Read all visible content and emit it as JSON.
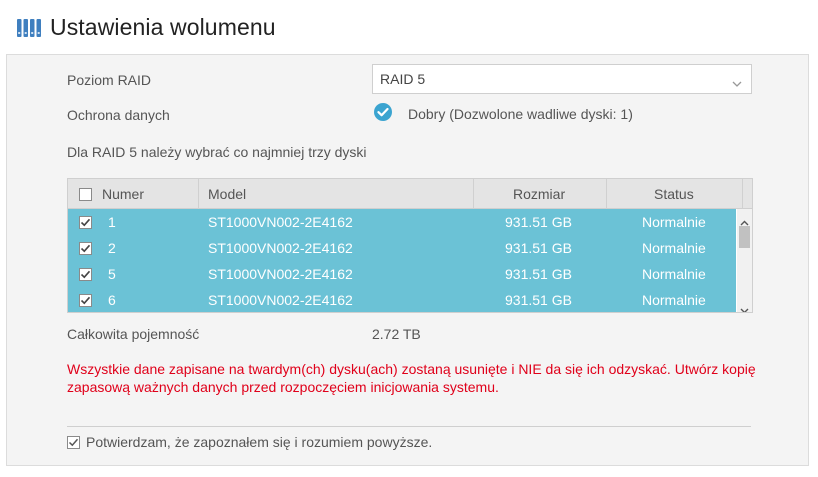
{
  "header": {
    "title": "Ustawienia wolumenu",
    "icon": "disk-stack-icon"
  },
  "form": {
    "raid_level_label": "Poziom RAID",
    "raid_level_value": "RAID 5",
    "protection_label": "Ochrona danych",
    "protection_value": "Dobry (Dozwolone wadliwe dyski: 1)",
    "hint": "Dla RAID 5 należy wybrać co najmniej trzy dyski"
  },
  "table": {
    "headers": {
      "number": "Numer",
      "model": "Model",
      "size": "Rozmiar",
      "status": "Status"
    },
    "header_checked": false,
    "rows": [
      {
        "checked": true,
        "number": "1",
        "model": "ST1000VN002-2E4162",
        "size": "931.51 GB",
        "status": "Normalnie"
      },
      {
        "checked": true,
        "number": "2",
        "model": "ST1000VN002-2E4162",
        "size": "931.51 GB",
        "status": "Normalnie"
      },
      {
        "checked": true,
        "number": "5",
        "model": "ST1000VN002-2E4162",
        "size": "931.51 GB",
        "status": "Normalnie"
      },
      {
        "checked": true,
        "number": "6",
        "model": "ST1000VN002-2E4162",
        "size": "931.51 GB",
        "status": "Normalnie"
      }
    ],
    "selected_row_color": "#6bc2d6"
  },
  "summary": {
    "capacity_label": "Całkowita pojemność",
    "capacity_value": "2.72 TB"
  },
  "warning": {
    "text": "Wszystkie dane zapisane na twardym(ch) dysku(ach) zostaną usunięte i NIE da się ich odzyskać. Utwórz kopię zapasową ważnych danych przed rozpoczęciem inicjowania systemu.",
    "color": "#e0001a"
  },
  "confirm": {
    "label": "Potwierdzam, że zapoznałem się i rozumiem powyższe.",
    "checked": true
  },
  "colors": {
    "accent": "#3ba4d0",
    "panel_bg": "#f4f4f4",
    "header_row_bg": "#e4e4e4"
  }
}
